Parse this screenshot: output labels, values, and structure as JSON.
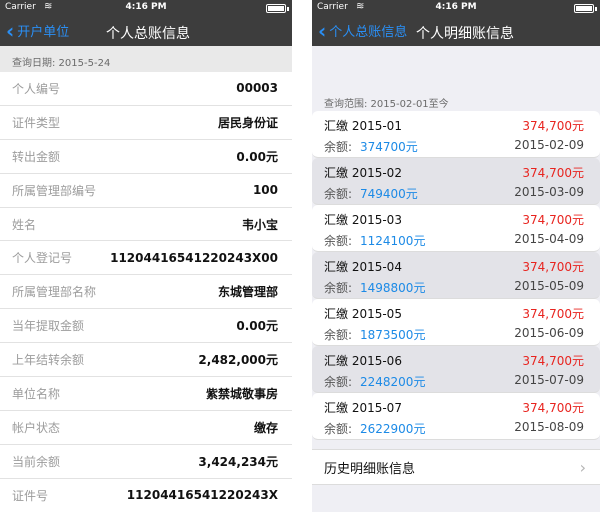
{
  "status": {
    "carrier": "Carrier",
    "time": "4:16 PM"
  },
  "left": {
    "back_label": "开户单位",
    "title": "个人总账信息",
    "query_date": "查询日期: 2015-5-24",
    "rows": [
      {
        "label": "个人编号",
        "value": "00003"
      },
      {
        "label": "证件类型",
        "value": "居民身份证"
      },
      {
        "label": "转出金额",
        "value": "0.00元"
      },
      {
        "label": "所属管理部编号",
        "value": "100"
      },
      {
        "label": "姓名",
        "value": "韦小宝"
      },
      {
        "label": "个人登记号",
        "value": "11204416541220243X00"
      },
      {
        "label": "所属管理部名称",
        "value": "东城管理部"
      },
      {
        "label": "当年提取金额",
        "value": "0.00元"
      },
      {
        "label": "上年结转余额",
        "value": "2,482,000元"
      },
      {
        "label": "单位名称",
        "value": "紫禁城敬事房"
      },
      {
        "label": "帐户状态",
        "value": "缴存"
      },
      {
        "label": "当前余额",
        "value": "3,424,234元"
      },
      {
        "label": "证件号",
        "value": "11204416541220243X"
      }
    ]
  },
  "right": {
    "back_label": "个人总账信息",
    "title": "个人明细账信息",
    "query_range": "查询范围: 2015-02-01至今",
    "balance_label": "余额:",
    "records": [
      {
        "name": "汇缴 2015-01",
        "amount": "374,700元",
        "balance": "374700元",
        "date": "2015-02-09"
      },
      {
        "name": "汇缴 2015-02",
        "amount": "374,700元",
        "balance": "749400元",
        "date": "2015-03-09"
      },
      {
        "name": "汇缴 2015-03",
        "amount": "374,700元",
        "balance": "1124100元",
        "date": "2015-04-09"
      },
      {
        "name": "汇缴 2015-04",
        "amount": "374,700元",
        "balance": "1498800元",
        "date": "2015-05-09"
      },
      {
        "name": "汇缴 2015-05",
        "amount": "374,700元",
        "balance": "1873500元",
        "date": "2015-06-09"
      },
      {
        "name": "汇缴 2015-06",
        "amount": "374,700元",
        "balance": "2248200元",
        "date": "2015-07-09"
      },
      {
        "name": "汇缴 2015-07",
        "amount": "374,700元",
        "balance": "2622900元",
        "date": "2015-08-09"
      }
    ],
    "history_label": "历史明细账信息"
  },
  "colors": {
    "navbar": "#3d3d3d",
    "back_link": "#2a8ff5",
    "amount_red": "#e8241f",
    "balance_blue": "#1c8ae6"
  },
  "icons": [
    "back-chevron-icon",
    "wifi-icon",
    "battery-icon",
    "chevron-right-icon"
  ]
}
